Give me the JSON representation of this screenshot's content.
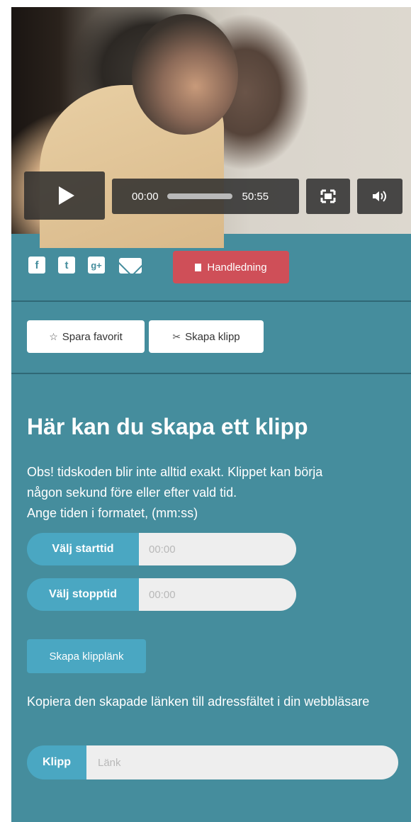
{
  "player": {
    "current_time": "00:00",
    "duration": "50:55",
    "progress": 0
  },
  "share": {
    "icons": [
      "facebook-icon",
      "twitter-icon",
      "google-plus-icon",
      "mail-icon"
    ],
    "facebook_glyph": "f",
    "twitter_glyph": "t",
    "gplus_glyph": "g+",
    "guide_label": "Handledning"
  },
  "actions": {
    "favorite_label": "Spara favorit",
    "clip_label": "Skapa klipp"
  },
  "clip": {
    "title": "Här kan du skapa ett klipp",
    "info_line1": "Obs! tidskoden blir inte alltid exakt. Klippet kan börja",
    "info_line2": "någon sekund före eller efter vald tid.",
    "info_line3": "Ange tiden i formatet, (mm:ss)",
    "start_label": "Välj starttid",
    "start_placeholder": "00:00",
    "stop_label": "Välj stopptid",
    "stop_placeholder": "00:00",
    "create_link_label": "Skapa klipplänk",
    "copy_text": "Kopiera den skapade länken till adressfältet i din webbläsare",
    "link_label": "Klipp",
    "link_placeholder": "Länk"
  },
  "colors": {
    "panel": "#458d9d",
    "accent": "#4aa7c2",
    "guide_button": "#cf4f58"
  }
}
